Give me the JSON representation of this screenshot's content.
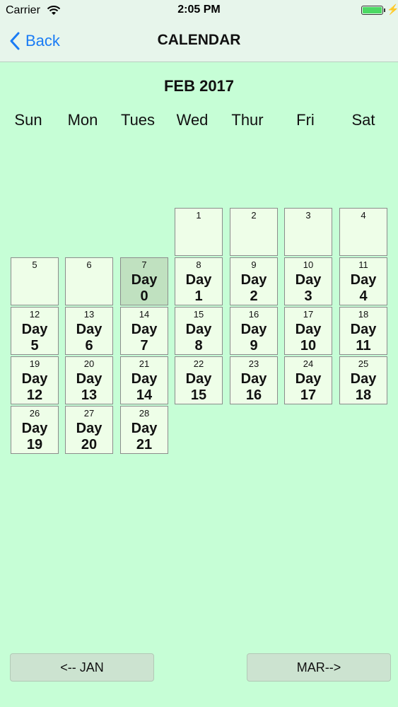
{
  "status_bar": {
    "carrier": "Carrier",
    "time": "2:05 PM"
  },
  "nav": {
    "back_label": "Back",
    "title": "CALENDAR"
  },
  "calendar": {
    "month_title": "FEB 2017",
    "weekdays": [
      "Sun",
      "Mon",
      "Tues",
      "Wed",
      "Thur",
      "Fri",
      "Sat"
    ],
    "day_prefix": "Day",
    "days": [
      {
        "date": "1",
        "day_num": ""
      },
      {
        "date": "2",
        "day_num": ""
      },
      {
        "date": "3",
        "day_num": ""
      },
      {
        "date": "4",
        "day_num": ""
      },
      {
        "date": "5",
        "day_num": ""
      },
      {
        "date": "6",
        "day_num": ""
      },
      {
        "date": "7",
        "day_num": "0",
        "today": true
      },
      {
        "date": "8",
        "day_num": "1"
      },
      {
        "date": "9",
        "day_num": "2"
      },
      {
        "date": "10",
        "day_num": "3"
      },
      {
        "date": "11",
        "day_num": "4"
      },
      {
        "date": "12",
        "day_num": "5"
      },
      {
        "date": "13",
        "day_num": "6"
      },
      {
        "date": "14",
        "day_num": "7"
      },
      {
        "date": "15",
        "day_num": "8"
      },
      {
        "date": "16",
        "day_num": "9"
      },
      {
        "date": "17",
        "day_num": "10"
      },
      {
        "date": "18",
        "day_num": "11"
      },
      {
        "date": "19",
        "day_num": "12"
      },
      {
        "date": "20",
        "day_num": "13"
      },
      {
        "date": "21",
        "day_num": "14"
      },
      {
        "date": "22",
        "day_num": "15"
      },
      {
        "date": "23",
        "day_num": "16"
      },
      {
        "date": "24",
        "day_num": "17"
      },
      {
        "date": "25",
        "day_num": "18"
      },
      {
        "date": "26",
        "day_num": "19"
      },
      {
        "date": "27",
        "day_num": "20"
      },
      {
        "date": "28",
        "day_num": "21"
      }
    ]
  },
  "footer": {
    "prev_label": "<-- JAN",
    "next_label": "MAR-->"
  },
  "colors": {
    "background": "#c6fed6",
    "cell": "#eefee8",
    "today_cell": "#c0e1c0",
    "back_link": "#1a7cf5"
  }
}
